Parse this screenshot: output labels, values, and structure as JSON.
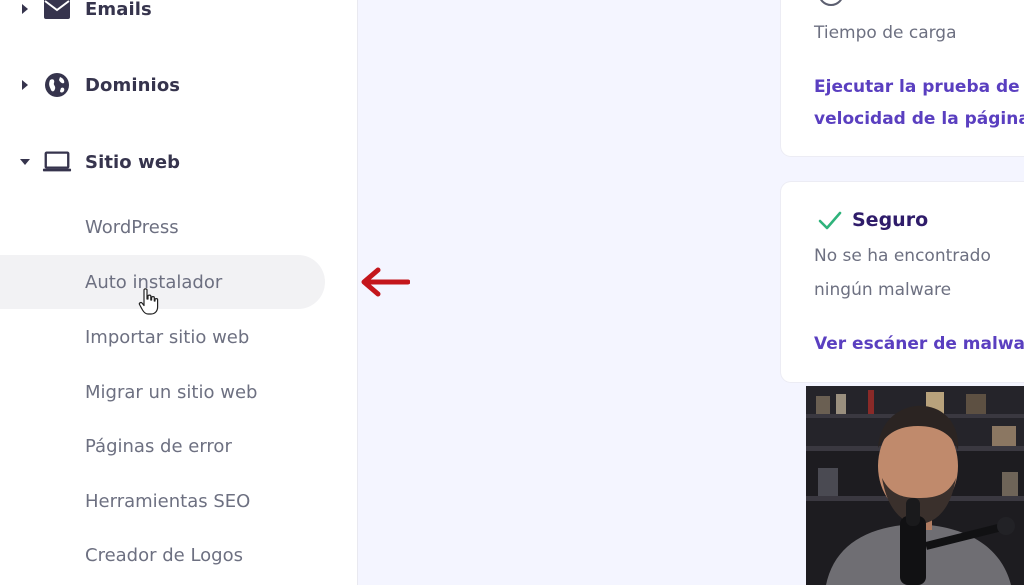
{
  "sidebar": {
    "groups": [
      {
        "label": "Emails",
        "icon": "mail-icon",
        "expanded": false
      },
      {
        "label": "Dominios",
        "icon": "globe-icon",
        "expanded": false
      },
      {
        "label": "Sitio web",
        "icon": "laptop-icon",
        "expanded": true
      }
    ],
    "items": [
      {
        "label": "WordPress"
      },
      {
        "label": "Auto instalador",
        "hovered": true
      },
      {
        "label": "Importar sitio web"
      },
      {
        "label": "Migrar un sitio web"
      },
      {
        "label": "Páginas de error"
      },
      {
        "label": "Herramientas SEO"
      },
      {
        "label": "Creador de Logos"
      }
    ]
  },
  "annotation": {
    "arrow_color": "#c4161c"
  },
  "cards": {
    "speed": {
      "subtitle": "Tiempo de carga",
      "link_line1": "Ejecutar la prueba de",
      "link_line2": "velocidad de la página"
    },
    "security": {
      "title": "Seguro",
      "desc_line1": "No se ha encontrado",
      "desc_line2": "ningún malware",
      "link": "Ver escáner de malware",
      "check_color": "#2fb37b"
    }
  },
  "colors": {
    "accent": "#5a3fc0",
    "background": "#f4f5ff"
  }
}
